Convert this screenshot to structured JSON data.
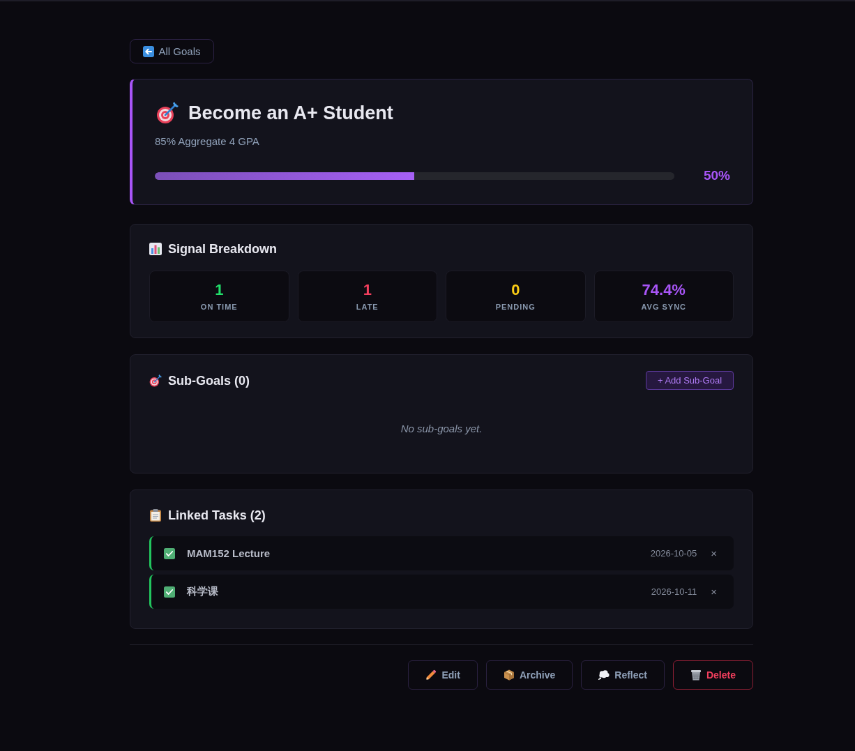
{
  "back_button": {
    "label": "All Goals"
  },
  "goal": {
    "title": "Become an A+ Student",
    "description": "85% Aggregate 4 GPA",
    "level": 0.5,
    "progress_text": "50%"
  },
  "signal_breakdown": {
    "title": "Signal Breakdown",
    "stats": [
      {
        "value": "1",
        "label": "ON TIME",
        "color": "#22e06b"
      },
      {
        "value": "1",
        "label": "LATE",
        "color": "#f43f5e"
      },
      {
        "value": "0",
        "label": "PENDING",
        "color": "#facc15"
      },
      {
        "value": "74.4%",
        "label": "AVG SYNC",
        "color": "#a855f7"
      }
    ]
  },
  "sub_goals": {
    "title": "Sub-Goals (0)",
    "add_button": "+ Add Sub-Goal",
    "empty_text": "No sub-goals yet."
  },
  "linked_tasks": {
    "title": "Linked Tasks (2)",
    "tasks": [
      {
        "title": "MAM152 Lecture",
        "date": "2026-10-05",
        "checked": true,
        "remove": "×"
      },
      {
        "title": "科学课",
        "date": "2026-10-11",
        "checked": true,
        "remove": "×"
      }
    ]
  },
  "actions": [
    {
      "label": "Edit",
      "kind": "edit"
    },
    {
      "label": "Archive",
      "kind": "archive"
    },
    {
      "label": "Reflect",
      "kind": "reflect"
    },
    {
      "label": "Delete",
      "kind": "delete"
    }
  ]
}
